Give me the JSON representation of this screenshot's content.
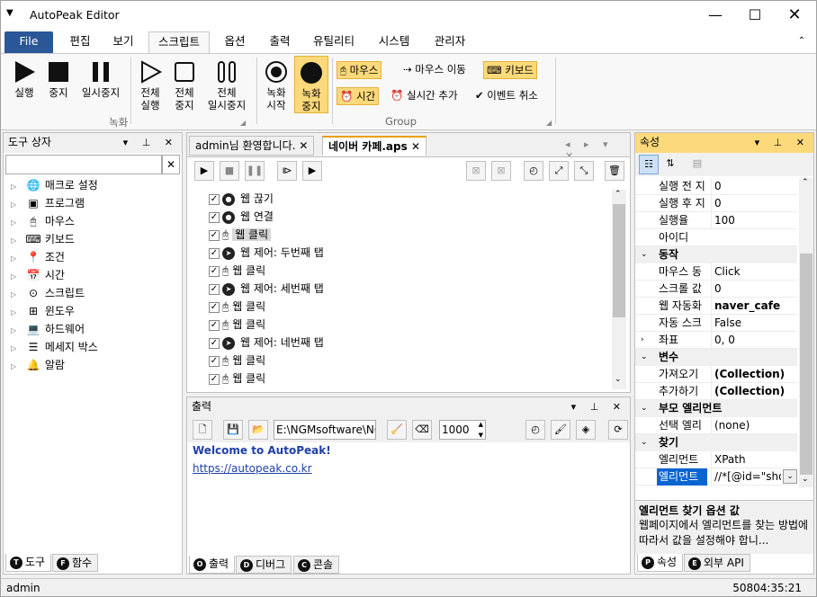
{
  "app": {
    "title": "AutoPeak Editor",
    "qa_icon": "dropdown-arrow-icon"
  },
  "menu": {
    "file": "File",
    "tabs": [
      "편집",
      "보기",
      "스크립트",
      "옵션",
      "출력",
      "유틸리티",
      "시스템",
      "관리자"
    ]
  },
  "ribbon": {
    "run": "실행",
    "stop": "중지",
    "pause": "일시중지",
    "all_run_1": "전체",
    "all_run_2": "실행",
    "all_stop_1": "전체",
    "all_stop_2": "중지",
    "all_pause_1": "전체",
    "all_pause_2": "일시중지",
    "rec_start_1": "녹화",
    "rec_start_2": "시작",
    "rec_stop_1": "녹화",
    "rec_stop_2": "중지",
    "group_record": "녹화",
    "mouse": "마우스",
    "mouse_move": "마우스 이동",
    "keyboard": "키보드",
    "time": "시간",
    "realtime_add": "실시간 추가",
    "event_cancel": "이벤트 취소",
    "group_group": "Group"
  },
  "toolbox": {
    "title": "도구 상자",
    "search_value": "",
    "items": [
      "매크로 설정",
      "프로그램",
      "마우스",
      "키보드",
      "조건",
      "시간",
      "스크립트",
      "윈도우",
      "하드웨어",
      "메세지 박스",
      "알람"
    ],
    "icons": [
      "globe-icon",
      "program-icon",
      "mouse-icon",
      "keyboard-icon",
      "pin-icon",
      "calendar-icon",
      "script-icon",
      "windows-icon",
      "laptop-icon",
      "message-box-icon",
      "bell-icon"
    ],
    "tab_tools": "도구",
    "tab_functions": "함수",
    "tab_tools_letter": "T",
    "tab_functions_letter": "F"
  },
  "editor": {
    "tabs": [
      {
        "label": "admin님 환영합니다."
      },
      {
        "label": "네이버 카페.aps"
      }
    ],
    "rows": [
      "웹 끊기",
      "웹 연결",
      "웹 클릭",
      "웹 제어: 두번째 탭",
      "웹 클릭",
      "웹 제어: 세번째 탭",
      "웹 클릭",
      "웹 클릭",
      "웹 제어: 네번째 탭",
      "웹 클릭",
      "웹 클릭"
    ],
    "selected_index": 2
  },
  "output": {
    "title": "출력",
    "path_value": "E:\\NGMsoftware\\NG",
    "number_value": "1000",
    "line1": "Welcome to AutoPeak!",
    "line2": "https://autopeak.co.kr",
    "tab_output": "출력",
    "tab_debug": "디버그",
    "tab_console": "콘솔",
    "tab_output_letter": "O",
    "tab_debug_letter": "D",
    "tab_console_letter": "C"
  },
  "properties": {
    "title": "속성",
    "rows": [
      {
        "k": "실행 전 지",
        "v": "0"
      },
      {
        "k": "실행 후 지",
        "v": "0"
      },
      {
        "k": "실행율",
        "v": "100"
      },
      {
        "k": "아이디",
        "v": ""
      }
    ],
    "cat_action": "동작",
    "action_rows": [
      {
        "k": "마우스 동",
        "v": "Click"
      },
      {
        "k": "스크롤 값",
        "v": "0"
      },
      {
        "k": "웹 자동화",
        "v": "naver_cafe"
      },
      {
        "k": "자동 스크",
        "v": "False"
      },
      {
        "k": "좌표",
        "v": "0, 0"
      }
    ],
    "cat_var": "변수",
    "var_rows": [
      {
        "k": "가져오기",
        "v": "(Collection)"
      },
      {
        "k": "추가하기",
        "v": "(Collection)"
      }
    ],
    "cat_parent": "부모 엘리먼트",
    "parent_rows": [
      {
        "k": "선택 엘리",
        "v": "(none)"
      }
    ],
    "cat_find": "찾기",
    "find_rows": [
      {
        "k": "엘리먼트",
        "v": "XPath"
      },
      {
        "k": "엘리먼트",
        "v": "//*[@id=\"sho"
      }
    ],
    "desc_title": "엘리먼트 찾기 옵션 값",
    "desc_text": "웹페이지에서 엘리먼트를 찾는 방법에 따라서 값을 설정해야 합니...",
    "tab_props": "속성",
    "tab_api": "외부 API",
    "tab_props_letter": "P",
    "tab_api_letter": "E"
  },
  "status": {
    "user": "admin",
    "time": "50804:35:21"
  }
}
